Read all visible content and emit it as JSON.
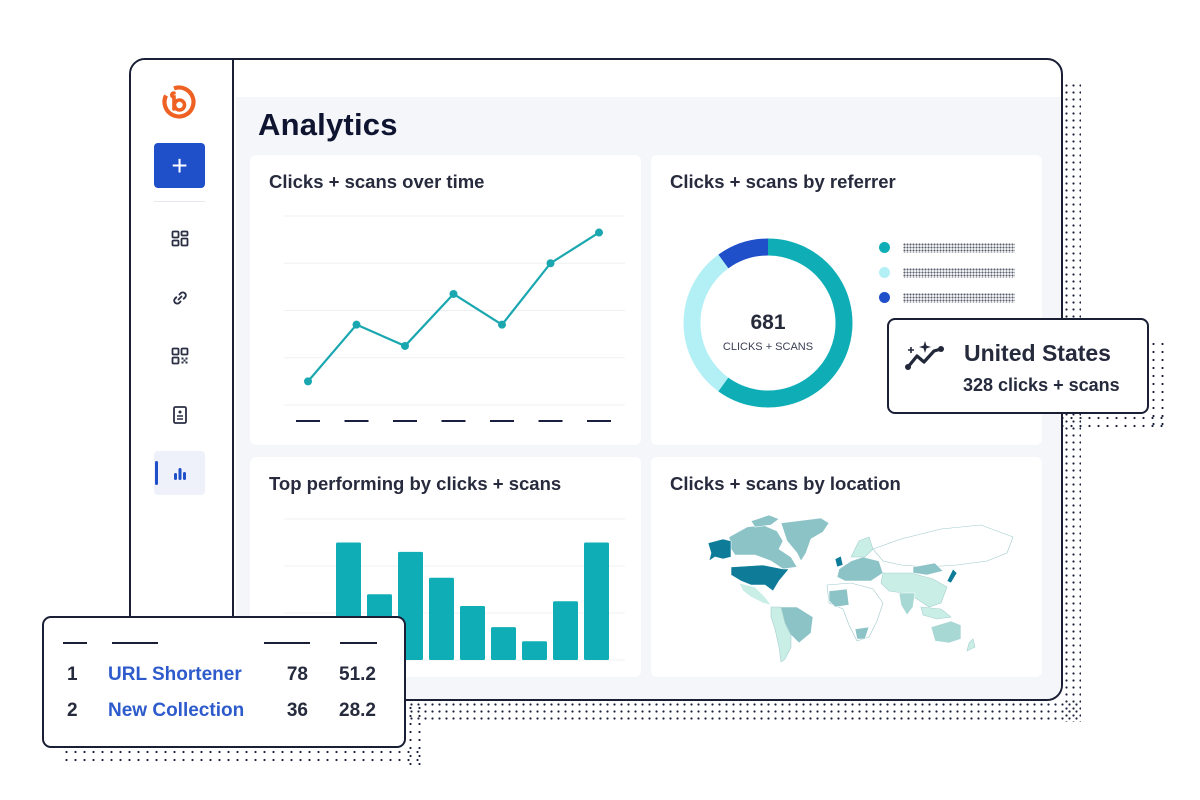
{
  "app": {
    "brand": "Bitly",
    "sidebar": {
      "create_label": "+",
      "items": [
        {
          "name": "home",
          "icon": "dashboard-grid-icon",
          "active": false
        },
        {
          "name": "links",
          "icon": "link-icon",
          "active": false
        },
        {
          "name": "qr-codes",
          "icon": "qr-code-icon",
          "active": false
        },
        {
          "name": "link-in-bio",
          "icon": "page-icon",
          "active": false
        },
        {
          "name": "analytics",
          "icon": "bar-chart-icon",
          "active": true
        }
      ]
    },
    "page_title": "Analytics"
  },
  "cards": {
    "over_time": {
      "title": "Clicks + scans over time"
    },
    "referrer": {
      "title": "Clicks + scans by referrer",
      "total": "681",
      "total_label": "CLICKS + SCANS"
    },
    "top_performing": {
      "title": "Top performing by clicks + scans"
    },
    "location": {
      "title": "Clicks + scans by location"
    }
  },
  "callout_us": {
    "icon": "trend-sparkle-icon",
    "country": "United States",
    "clicks_label": "328 clicks + scans"
  },
  "callout_table": {
    "rows": [
      {
        "rank": "1",
        "name": "URL Shortener",
        "clicks": "78",
        "percent": "51.2"
      },
      {
        "rank": "2",
        "name": "New Collection",
        "clicks": "36",
        "percent": "28.2"
      }
    ]
  },
  "colors": {
    "brand_blue": "#1f4fc9",
    "teal": "#0faeb7",
    "teal_light": "#b3f0f5",
    "blue": "#1f4fc9",
    "logo_orange": "#ee6123",
    "map_dark": "#0e7c99",
    "map_mid": "#8cc3c7",
    "map_light": "#c8eee6"
  },
  "chart_data": [
    {
      "type": "line",
      "title": "Clicks + scans over time",
      "x": [
        "",
        "",
        "",
        "",
        "",
        "",
        ""
      ],
      "values": [
        0.5,
        1.7,
        1.25,
        2.35,
        1.7,
        3.0,
        3.65
      ],
      "ylim": [
        0,
        4
      ],
      "grid": true,
      "xlabel": "",
      "ylabel": "",
      "color": "#1aa7b0"
    },
    {
      "type": "pie",
      "title": "Clicks + scans by referrer",
      "donut": true,
      "total": 681,
      "series": [
        {
          "name": "",
          "value": 60,
          "color": "#0faeb7"
        },
        {
          "name": "",
          "value": 30,
          "color": "#b3f0f5"
        },
        {
          "name": "",
          "value": 10,
          "color": "#1f4fc9"
        }
      ],
      "legend": "right"
    },
    {
      "type": "bar",
      "title": "Top performing by clicks + scans",
      "categories": [
        "",
        "",
        "",
        "",
        "",
        "",
        "",
        "",
        ""
      ],
      "values": [
        2.5,
        1.4,
        2.3,
        1.75,
        1.15,
        0.7,
        0.4,
        1.25,
        2.5
      ],
      "ylim": [
        0,
        3
      ],
      "grid": true,
      "color": "#0faeb7"
    }
  ]
}
